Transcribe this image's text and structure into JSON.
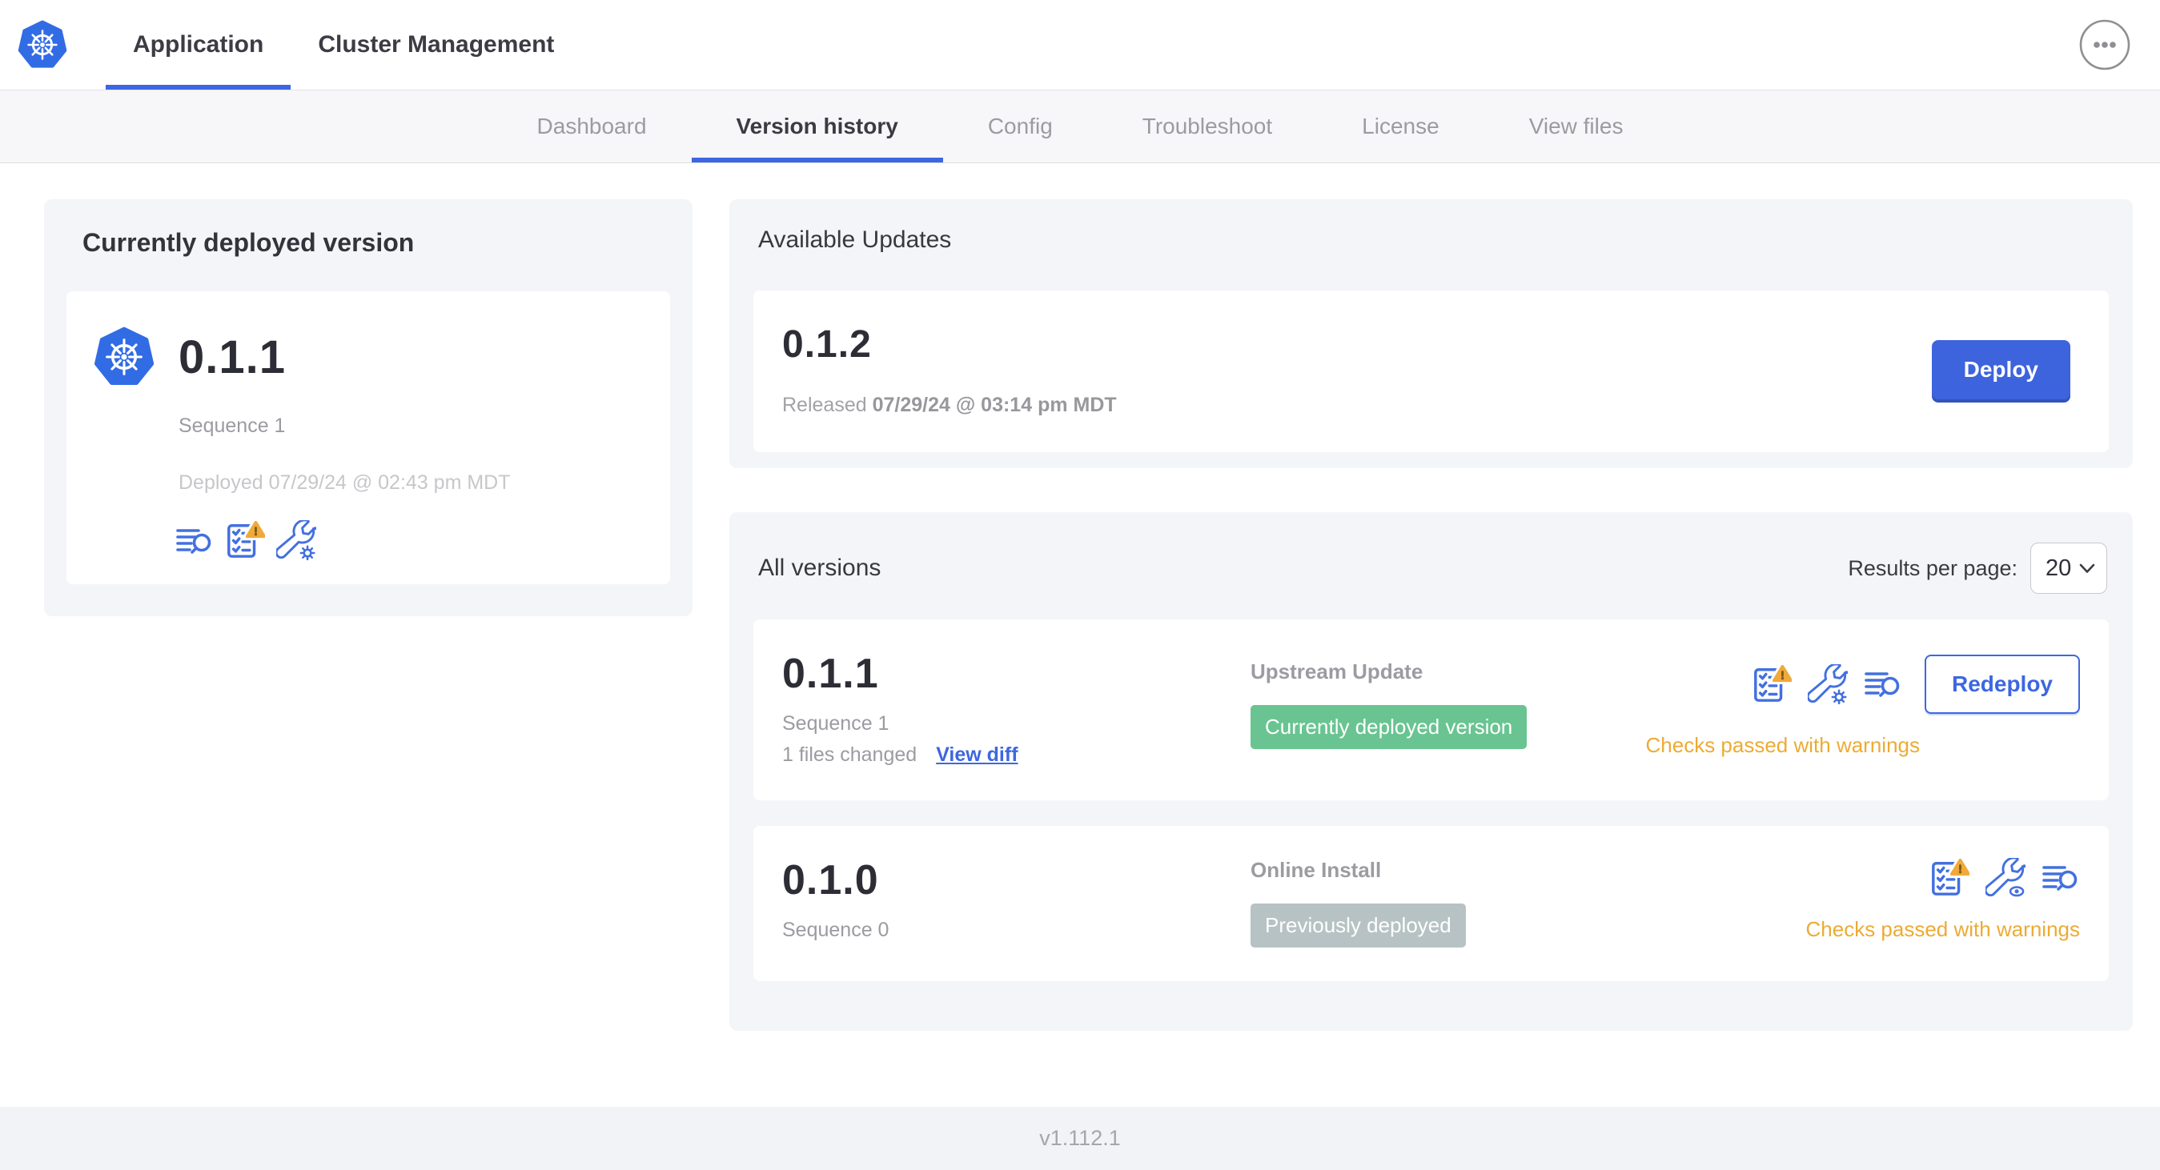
{
  "header": {
    "tabs": [
      {
        "label": "Application",
        "active": true
      },
      {
        "label": "Cluster Management",
        "active": false
      }
    ]
  },
  "subnav": {
    "tabs": [
      {
        "label": "Dashboard",
        "active": false
      },
      {
        "label": "Version history",
        "active": true
      },
      {
        "label": "Config",
        "active": false
      },
      {
        "label": "Troubleshoot",
        "active": false
      },
      {
        "label": "License",
        "active": false
      },
      {
        "label": "View files",
        "active": false
      }
    ]
  },
  "current_version": {
    "title": "Currently deployed version",
    "version": "0.1.1",
    "sequence": "Sequence 1",
    "deployed": "Deployed 07/29/24 @ 02:43 pm MDT",
    "icons": [
      "diff-icon",
      "preflight-checks-warning-icon",
      "config-wrench-gear-icon"
    ]
  },
  "available_updates": {
    "title": "Available Updates",
    "version": "0.1.2",
    "released_prefix": "Released",
    "released_date": "07/29/24 @ 03:14 pm MDT",
    "deploy_label": "Deploy"
  },
  "all_versions": {
    "title": "All versions",
    "results_per_page_label": "Results per page:",
    "results_per_page_value": "20",
    "rows": [
      {
        "version": "0.1.1",
        "sequence": "Sequence 1",
        "files_changed": "1 files changed",
        "view_diff_label": "View diff",
        "source": "Upstream Update",
        "badge_label": "Currently deployed version",
        "badge_color": "#69c491",
        "checks_text": "Checks passed with warnings",
        "action_label": "Redeploy",
        "icons": [
          "preflight-checks-warning-icon",
          "config-wrench-gear-icon",
          "diff-icon"
        ]
      },
      {
        "version": "0.1.0",
        "sequence": "Sequence 0",
        "source": "Online Install",
        "badge_label": "Previously deployed",
        "badge_color": "#b7c2c4",
        "checks_text": "Checks passed with warnings",
        "icons": [
          "preflight-checks-warning-icon",
          "config-wrench-eye-icon",
          "diff-icon"
        ]
      }
    ]
  },
  "footer": {
    "app_version": "v1.112.1"
  },
  "colors": {
    "accent_blue": "#3d67e0",
    "kubernetes_blue": "#326ce5",
    "icon_blue": "#4370e0",
    "badge_green": "#69c491",
    "badge_gray": "#b7c2c4",
    "warning_orange": "#ecab33"
  }
}
